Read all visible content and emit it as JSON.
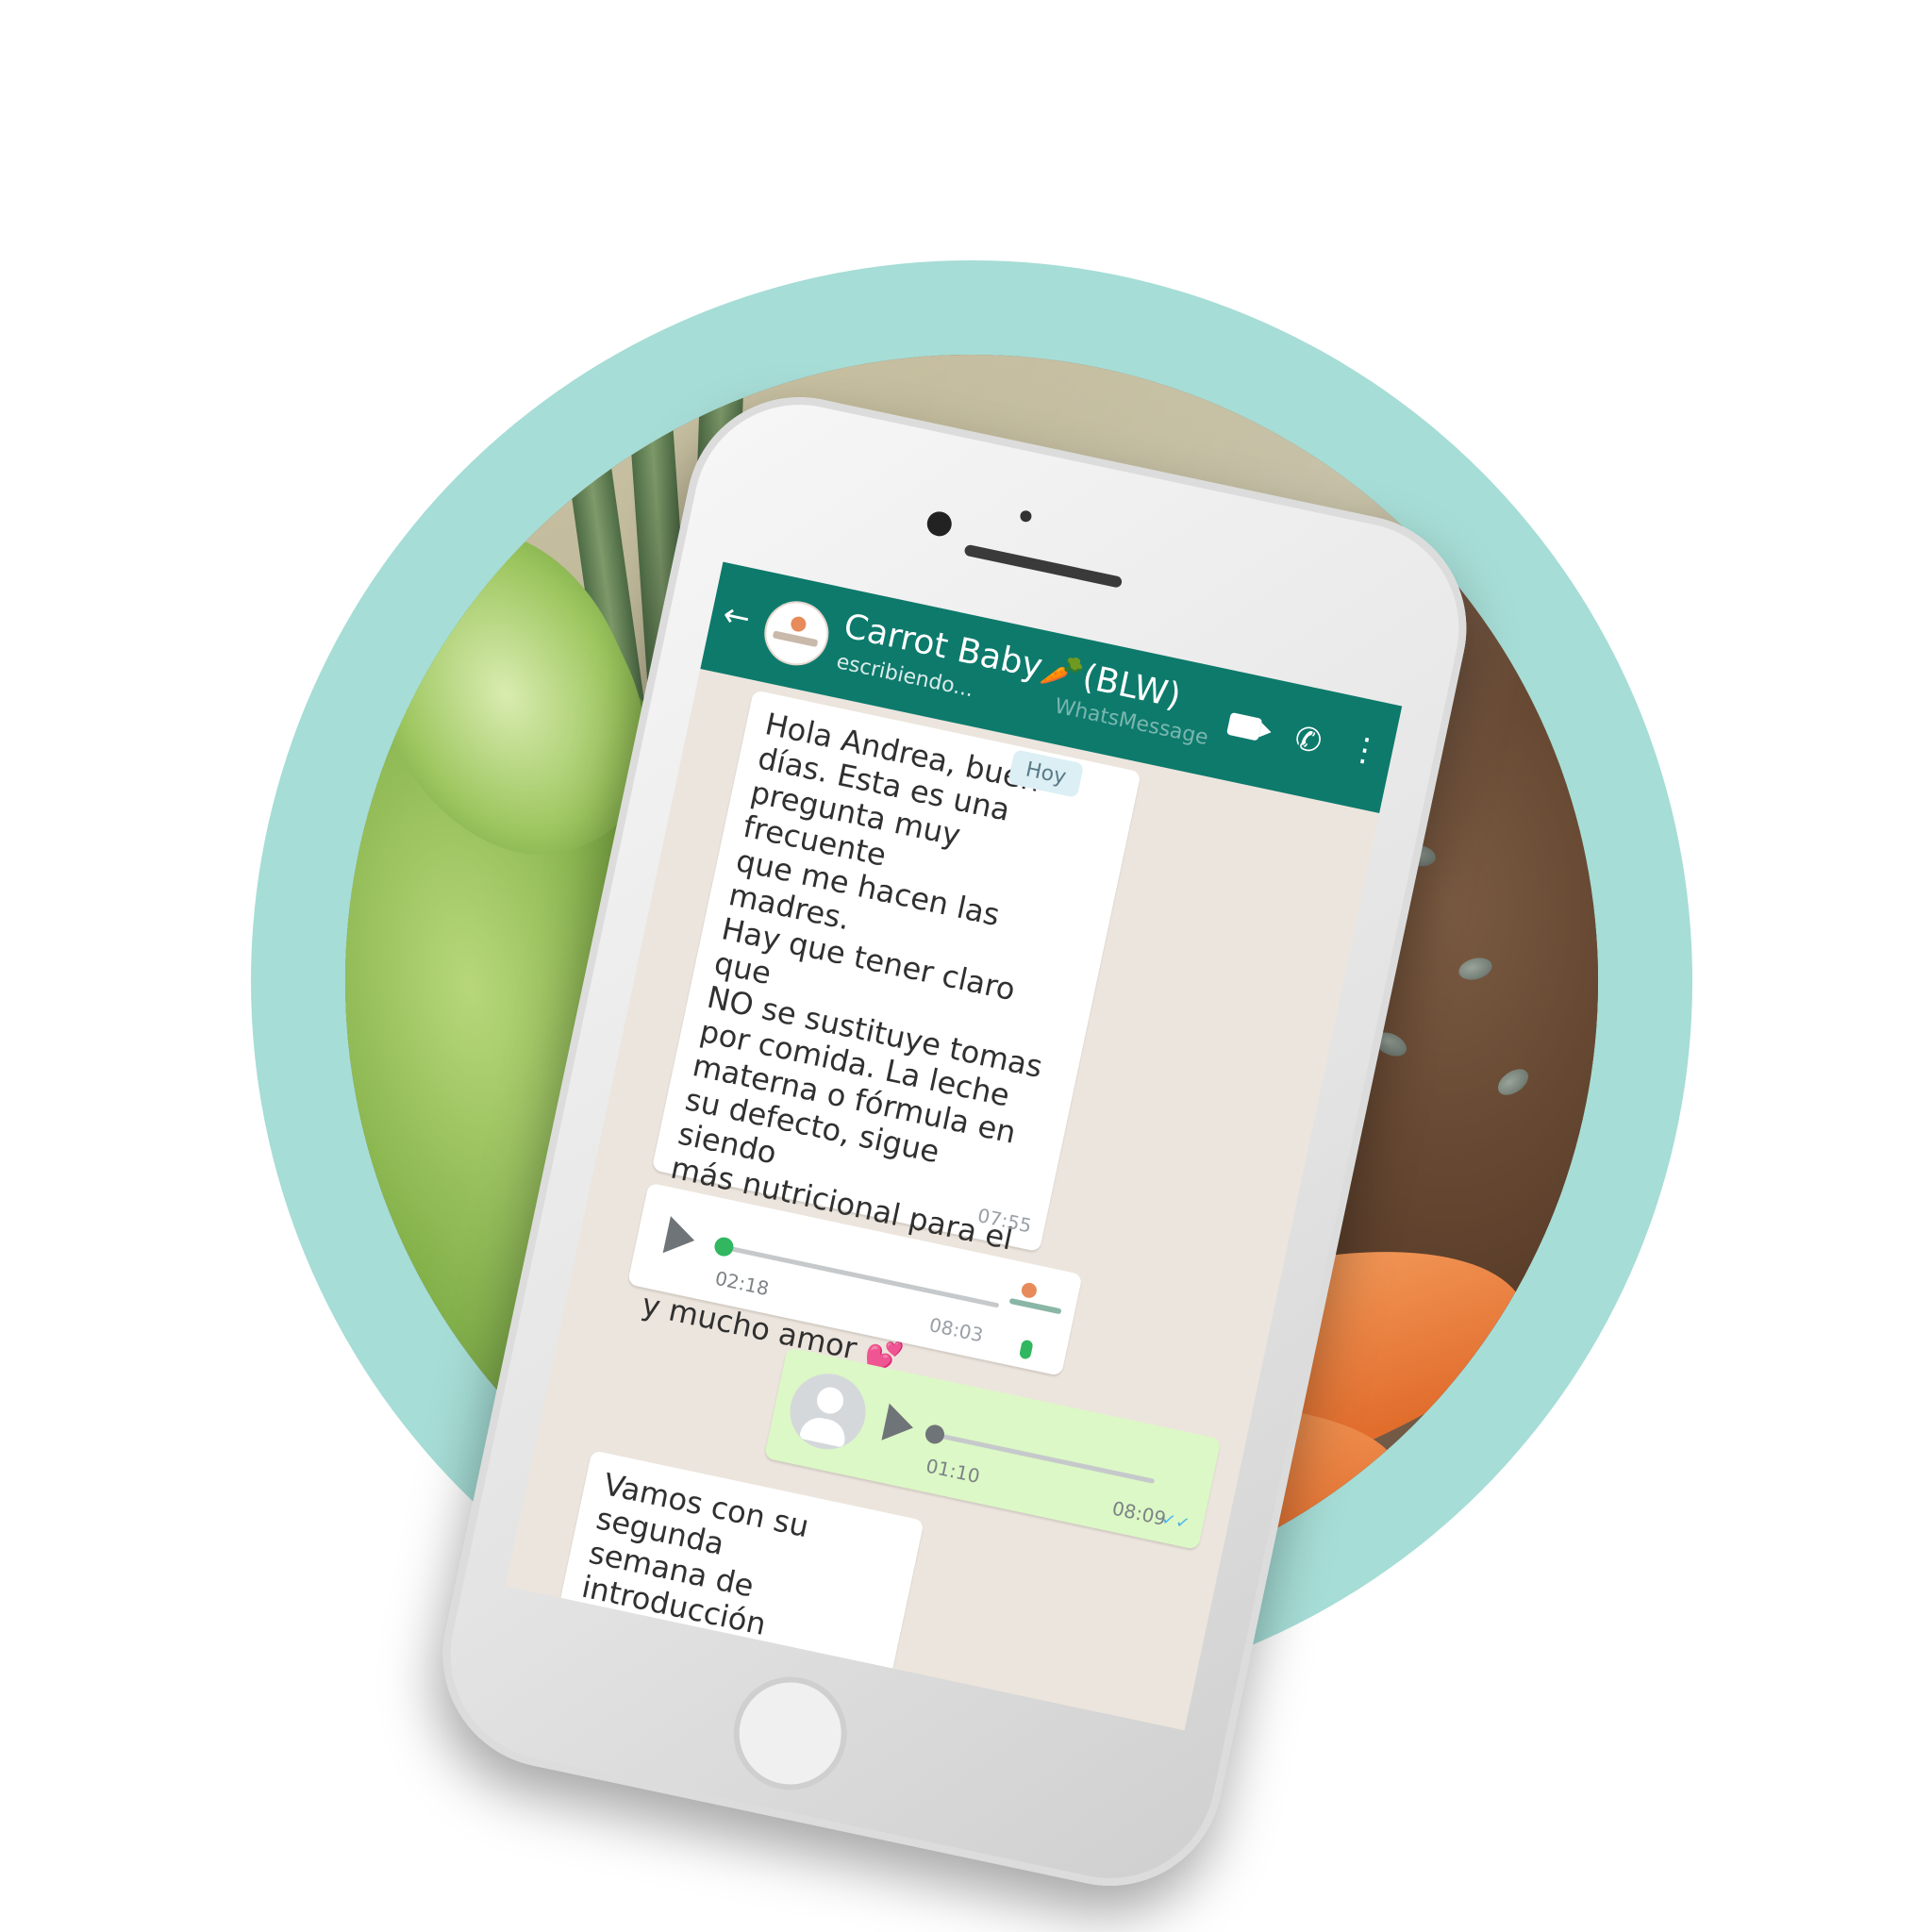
{
  "chat": {
    "name": "Carrot Baby🥕(BLW)",
    "status": "escribiendo...",
    "watermark": "WhatsMessage",
    "date_pill": "Hoy"
  },
  "messages": [
    {
      "type": "text",
      "text": "Hola Andrea, buen\ndías. Esta es una\npregunta muy frecuente\nque me hacen las\nmadres.\nHay que tener claro que\nNO se sustituye tomas\npor comida. La leche\nmaterna o fórmula en\nsu defecto, sigue siendo\nmás nutricional para el\nbebé que los mismos\nalimentos. Hay que\ndarle tiempo, paciencia\ny mucho amor",
      "emoji": "💕",
      "time": "07:55"
    },
    {
      "type": "audio",
      "duration": "02:18",
      "time": "08:03"
    },
    {
      "type": "audio_out",
      "duration": "01:10",
      "time": "08:09",
      "ticks": "✓✓"
    },
    {
      "type": "text",
      "text": "Vamos con su segunda\nsemana de introducción\nde alimentos, la\nplaneamos pero no\nsiempre va a salir como\nqueremos, Matthew"
    }
  ],
  "icons": {
    "back": "←",
    "call": "✆",
    "menu": "⋮"
  },
  "colors": {
    "ring": "#a6ddd6",
    "topbar": "#0d7a6c",
    "chat_bg": "#ece5dd",
    "outgoing": "#dcf8c6"
  }
}
